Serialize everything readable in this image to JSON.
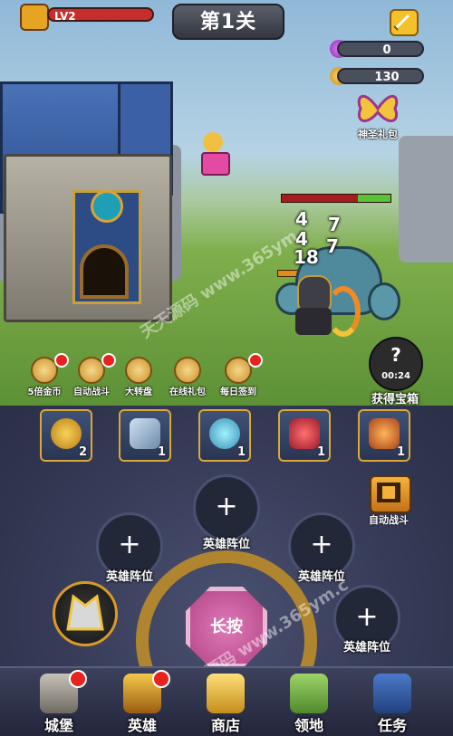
{
  "top_bar": {
    "level": "LV2",
    "stage_title": "第1关",
    "gems": "0",
    "gold": "130",
    "gift_label": "神圣礼包"
  },
  "battle": {
    "damage_numbers": [
      "4",
      "7",
      "4",
      "7",
      "18"
    ],
    "enemy_hp_ratio": 0.3
  },
  "quick_actions": [
    {
      "label": "5倍金币",
      "badge": true
    },
    {
      "label": "自动战斗",
      "badge": true
    },
    {
      "label": "大转盘",
      "badge": false
    },
    {
      "label": "在线礼包",
      "badge": false
    },
    {
      "label": "每日签到",
      "badge": true
    }
  ],
  "chest": {
    "timer": "00:24",
    "label": "获得宝箱",
    "icon": "?"
  },
  "items": [
    {
      "icon": "gold-coins-icon",
      "count": "2"
    },
    {
      "icon": "hammer-icon",
      "count": "1"
    },
    {
      "icon": "potion-icon",
      "count": "1"
    },
    {
      "icon": "helmet-icon",
      "count": "1"
    },
    {
      "icon": "armor-icon",
      "count": "1"
    }
  ],
  "auto_battle": {
    "label": "自动战斗"
  },
  "positions": [
    {
      "label": "英雄阵位",
      "plus": "+"
    },
    {
      "label": "英雄阵位",
      "plus": "+"
    },
    {
      "label": "英雄阵位",
      "plus": "+"
    },
    {
      "label": "英雄阵位",
      "plus": "+"
    }
  ],
  "hold_button": {
    "label": "长按"
  },
  "nav": [
    {
      "label": "城堡",
      "badge": true
    },
    {
      "label": "英雄",
      "badge": true
    },
    {
      "label": "商店",
      "badge": false
    },
    {
      "label": "领地",
      "badge": false
    },
    {
      "label": "任务",
      "badge": false
    }
  ],
  "watermarks": [
    "天天源码 www.365ym",
    "天天源码 www.365ym.c"
  ],
  "colors": {
    "accent_gold": "#d9a73a",
    "badge_red": "#e8231f",
    "hold_pink": "#c45595"
  }
}
